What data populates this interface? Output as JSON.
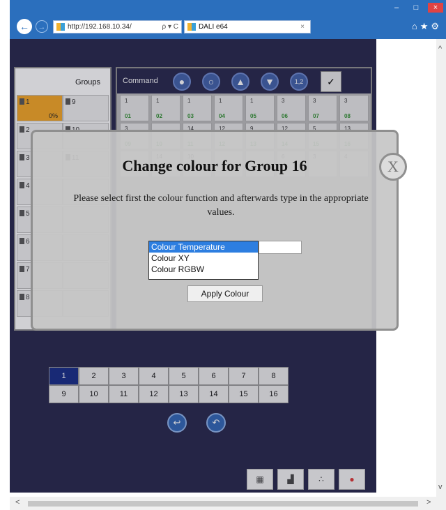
{
  "browser": {
    "url": "http://192.168.10.34/",
    "address_tools": "ρ ▾ C",
    "tab_title": "DALI e64",
    "tab_close": "×",
    "window_min": "–",
    "window_max": "□",
    "window_close": "×"
  },
  "groups": {
    "title": "Groups",
    "items": [
      {
        "label": "1",
        "value": "0%"
      },
      {
        "label": "9",
        "value": ""
      },
      {
        "label": "2",
        "value": ""
      },
      {
        "label": "10",
        "value": ""
      },
      {
        "label": "3",
        "value": ""
      },
      {
        "label": "11",
        "value": ""
      },
      {
        "label": "4",
        "value": ""
      },
      {
        "label": "5",
        "value": ""
      },
      {
        "label": "6",
        "value": ""
      },
      {
        "label": "7",
        "value": ""
      },
      {
        "label": "8",
        "value": ""
      }
    ]
  },
  "command": {
    "label": "Command",
    "icons": [
      "bulb-on-icon",
      "bulb-off-icon",
      "bulb-up-icon",
      "bulb-down-icon",
      "scene-12-icon",
      "select-icon"
    ],
    "device_rows": [
      [
        {
          "group": "1",
          "id": "01"
        },
        {
          "group": "1",
          "id": "02"
        },
        {
          "group": "1",
          "id": "03"
        },
        {
          "group": "1",
          "id": "04"
        },
        {
          "group": "1",
          "id": "05"
        },
        {
          "group": "3",
          "id": "06"
        },
        {
          "group": "3",
          "id": "07"
        },
        {
          "group": "3",
          "id": "08"
        }
      ],
      [
        {
          "group": "3",
          "id": "09"
        },
        {
          "group": "",
          "id": "10"
        },
        {
          "group": "14",
          "id": "11"
        },
        {
          "group": "12",
          "id": "12"
        },
        {
          "group": "9",
          "id": "13"
        },
        {
          "group": "12",
          "id": "14"
        },
        {
          "group": "5",
          "id": "15"
        },
        {
          "group": "13",
          "id": "16"
        }
      ],
      [
        {
          "group": "",
          "id": ""
        },
        {
          "group": "14",
          "id": ""
        },
        {
          "group": "10",
          "id": ""
        },
        {
          "group": "",
          "id": ""
        },
        {
          "group": "",
          "id": ""
        },
        {
          "group": "6",
          "id": ""
        },
        {
          "group": "3",
          "id": ""
        },
        {
          "group": "4",
          "id": ""
        }
      ]
    ]
  },
  "pages": {
    "row1": [
      "1",
      "2",
      "3",
      "4",
      "5",
      "6",
      "7",
      "8"
    ],
    "row2": [
      "9",
      "10",
      "11",
      "12",
      "13",
      "14",
      "15",
      "16"
    ],
    "active": "1"
  },
  "dialog": {
    "title": "Change colour for Group 16",
    "message": "Please select first the colour function and afterwards type in the appropriate values.",
    "close_label": "X",
    "colour_options": [
      "Colour Temperature",
      "Colour XY",
      "Colour RGBW"
    ],
    "selected_option": "Colour Temperature",
    "apply_label": "Apply Colour"
  },
  "colors": {
    "app_background": "#24244a",
    "selected_group": "#f5a622",
    "active_page": "#142a86",
    "device_id_green": "#2f8f2f"
  }
}
